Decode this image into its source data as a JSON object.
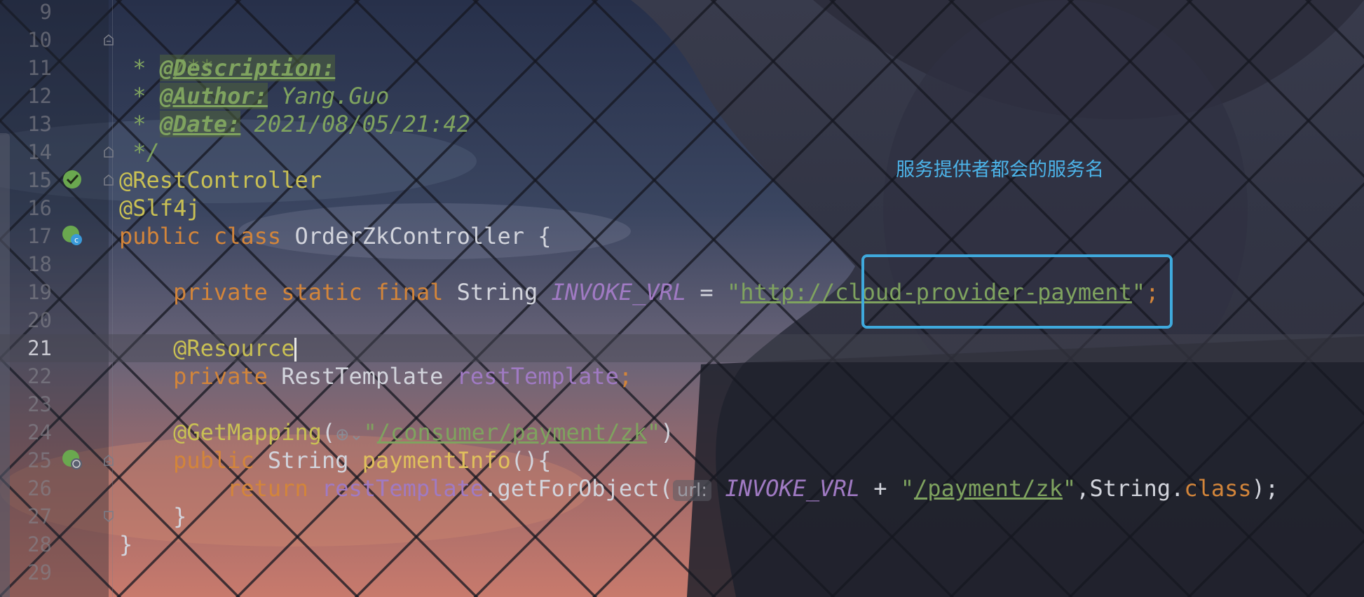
{
  "gutter": {
    "line_numbers": [
      "9",
      "10",
      "11",
      "12",
      "13",
      "14",
      "15",
      "16",
      "17",
      "18",
      "19",
      "20",
      "21",
      "22",
      "23",
      "24",
      "25",
      "26",
      "27",
      "28",
      "29"
    ],
    "active_line": "21"
  },
  "code": {
    "l10": "/**",
    "l11_prefix": " * ",
    "l11_tag": "@Description:",
    "l12_prefix": " * ",
    "l12_tag": "@Author:",
    "l12_val": " Yang.Guo",
    "l13_prefix": " * ",
    "l13_tag": "@Date:",
    "l13_val": " 2021/08/05/21:42",
    "l14": " */",
    "l15": "@RestController",
    "l16": "@Slf4j",
    "l17_kw1": "public",
    "l17_kw2": " class",
    "l17_rest": " OrderZkController {",
    "l19_indent": "    ",
    "l19_kw": "private static final",
    "l19_type": " String ",
    "l19_const": "INVOKE_VRL",
    "l19_eq": " = ",
    "l19_q1": "\"",
    "l19_url": "http://cloud-provider-payment",
    "l19_q2": "\"",
    "l19_end": ";",
    "l21_indent": "    ",
    "l21_ann": "@Resource",
    "l22_indent": "    ",
    "l22_kw": "private",
    "l22_type": " RestTemplate ",
    "l22_field": "restTemplate",
    "l22_end": ";",
    "l24_indent": "    ",
    "l24_ann": "@GetMapping",
    "l24_open": "(",
    "l24_icon": "⊕⌄",
    "l24_q1": "\"",
    "l24_path": "/consumer/payment/zk",
    "l24_q2": "\"",
    "l24_close": ")",
    "l25_indent": "    ",
    "l25_kw": "public",
    "l25_type": " String ",
    "l25_meth": "paymentInfo",
    "l25_rest": "(){",
    "l26_indent": "        ",
    "l26_kw": "return",
    "l26_sp": " ",
    "l26_field": "restTemplate",
    "l26_call": ".getForObject(",
    "l26_hint": "url:",
    "l26_sp2": " ",
    "l26_const": "INVOKE_VRL",
    "l26_plus": " + ",
    "l26_q1": "\"",
    "l26_path": "/payment/zk",
    "l26_q2": "\"",
    "l26_mid": ",String.",
    "l26_kw2": "class",
    "l26_end": ");",
    "l27": "    }",
    "l28": "}"
  },
  "annotation": {
    "note_text": "服务提供者都会的服务名",
    "box_color": "#3fa9dc"
  },
  "theme": {
    "keyword": "#d3853a",
    "annotation": "#c9c054",
    "string": "#7fa35f",
    "field": "#a07ac3"
  },
  "icons": {
    "line15": "spring-bean-icon",
    "line17": "spring-controller-icon",
    "line25": "web-endpoint-icon",
    "line24": "globe-icon"
  }
}
